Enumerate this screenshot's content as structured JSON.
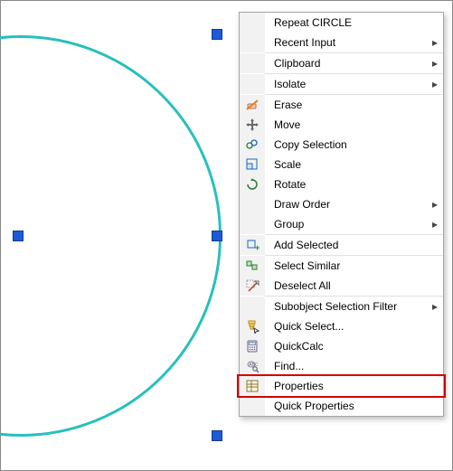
{
  "menu": {
    "items": [
      {
        "label": "Repeat CIRCLE",
        "icon": null,
        "sub": false
      },
      {
        "label": "Recent Input",
        "icon": null,
        "sub": true
      },
      {
        "sep": true
      },
      {
        "label": "Clipboard",
        "icon": null,
        "sub": true
      },
      {
        "sep": true
      },
      {
        "label": "Isolate",
        "icon": null,
        "sub": true
      },
      {
        "sep": true
      },
      {
        "label": "Erase",
        "icon": "eraser",
        "sub": false
      },
      {
        "label": "Move",
        "icon": "move",
        "sub": false
      },
      {
        "label": "Copy Selection",
        "icon": "copy",
        "sub": false
      },
      {
        "label": "Scale",
        "icon": "scale",
        "sub": false
      },
      {
        "label": "Rotate",
        "icon": "rotate",
        "sub": false
      },
      {
        "label": "Draw Order",
        "icon": null,
        "sub": true
      },
      {
        "label": "Group",
        "icon": null,
        "sub": true
      },
      {
        "sep": true
      },
      {
        "label": "Add Selected",
        "icon": "add-selected",
        "sub": false
      },
      {
        "sep": true
      },
      {
        "label": "Select Similar",
        "icon": "select-similar",
        "sub": false
      },
      {
        "label": "Deselect All",
        "icon": "deselect",
        "sub": false
      },
      {
        "sep": true
      },
      {
        "label": "Subobject Selection Filter",
        "icon": null,
        "sub": true
      },
      {
        "label": "Quick Select...",
        "icon": "quick-select",
        "sub": false
      },
      {
        "label": "QuickCalc",
        "icon": "calc",
        "sub": false
      },
      {
        "label": "Find...",
        "icon": "find",
        "sub": false
      },
      {
        "label": "Properties",
        "icon": "properties",
        "sub": false,
        "highlight": true
      },
      {
        "label": "Quick Properties",
        "icon": null,
        "sub": false
      }
    ]
  },
  "circle": {
    "color": "#27c0bd"
  },
  "grips": {
    "color": "#1b5bd8"
  }
}
